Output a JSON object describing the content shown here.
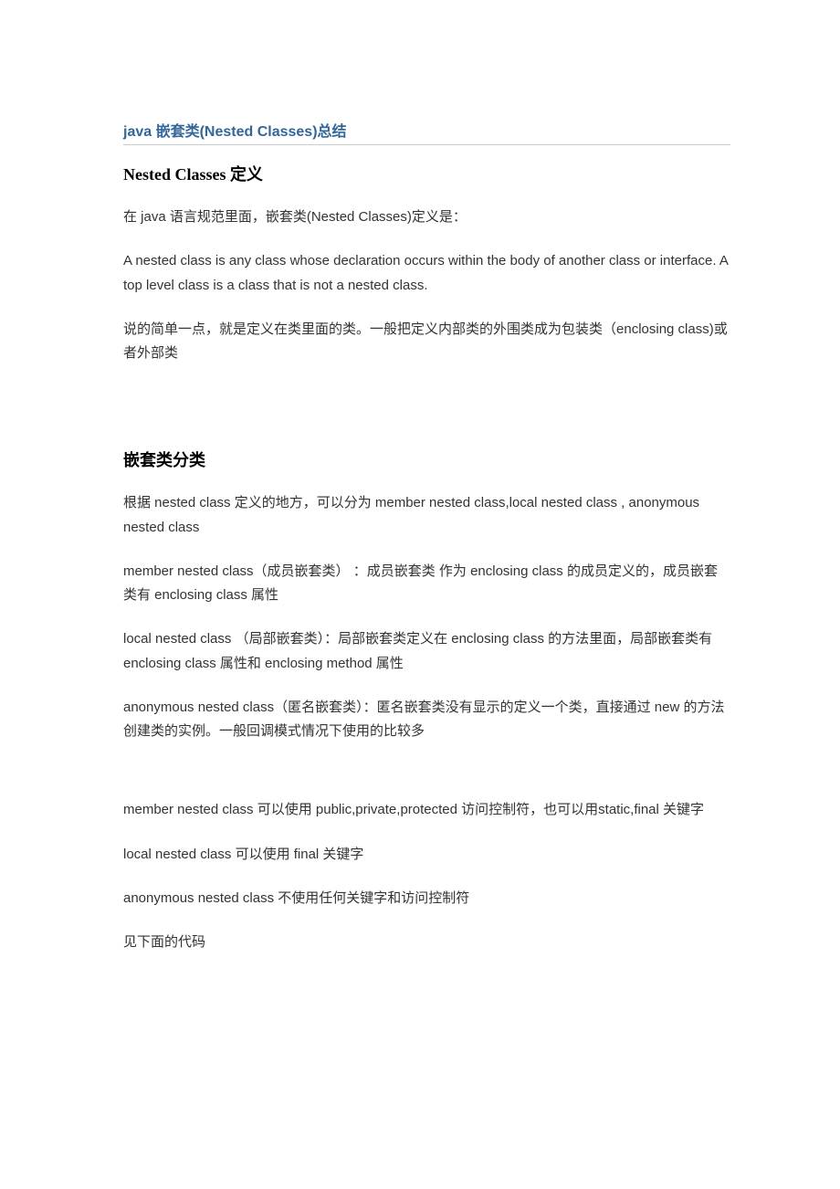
{
  "title_link": "java 嵌套类(Nested Classes)总结",
  "section1": {
    "heading": "Nested Classes 定义",
    "p1": "在 java 语言规范里面，嵌套类(Nested Classes)定义是：",
    "p2": "A nested class is any class whose declaration occurs within the body of another class or interface. A top level class is a class that is not a nested class.",
    "p3": "说的简单一点，就是定义在类里面的类。一般把定义内部类的外围类成为包装类（enclosing class)或者外部类"
  },
  "section2": {
    "heading": "嵌套类分类",
    "p1": "根据 nested class 定义的地方，可以分为 member nested class,local nested class , anonymous nested class",
    "p2": "member nested class（成员嵌套类） ：成员嵌套类 作为 enclosing class  的成员定义的，成员嵌套类有 enclosing class 属性",
    "p3": "local nested class （局部嵌套类）：局部嵌套类定义在 enclosing class  的方法里面，局部嵌套类有 enclosing class  属性和 enclosing method  属性",
    "p4": "anonymous nested class（匿名嵌套类）：匿名嵌套类没有显示的定义一个类，直接通过 new  的方法创建类的实例。一般回调模式情况下使用的比较多",
    "p5": "member nested class 可以使用 public,private,protected 访问控制符，也可以用static,final 关键字",
    "p6": "local nested class  可以使用 final 关键字",
    "p7": "anonymous nested class  不使用任何关键字和访问控制符",
    "p8": "见下面的代码"
  }
}
